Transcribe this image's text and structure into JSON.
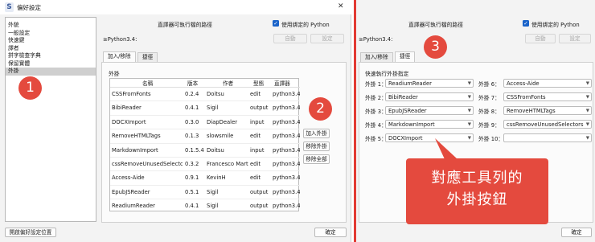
{
  "window": {
    "title": "偏好設定",
    "close": "✕"
  },
  "categories": [
    "外貌",
    "一般設定",
    "快速鍵",
    "譯者",
    "拼字檢查字典",
    "保留實體",
    "外掛"
  ],
  "selected_category": "外掛",
  "top": {
    "interpreter_label": "直譯器可執行檔的路徑",
    "use_bundled_python": "使用綁定的 Python",
    "path_value": "≥Python3.4:",
    "auto_btn": "自動",
    "set_btn": "設定"
  },
  "tabs": [
    "加入/移除",
    "捷徑"
  ],
  "plugins_section_label": "外掛",
  "table": {
    "headers": [
      "名稱",
      "版本",
      "作者",
      "型態",
      "直譯器"
    ],
    "rows": [
      [
        "CSSFromFonts",
        "0.2.4",
        "Doitsu",
        "edit",
        "python3.4"
      ],
      [
        "BibiReader",
        "0.4.1",
        "Sigil",
        "output",
        "python3.4"
      ],
      [
        "DOCXImport",
        "0.3.0",
        "DiapDealer",
        "input",
        "python3.4"
      ],
      [
        "RemoveHTMLTags",
        "0.1.3",
        "slowsmile",
        "edit",
        "python3.4"
      ],
      [
        "MarkdownImport",
        "0.1.5.4",
        "Doitsu",
        "input",
        "python3.4"
      ],
      [
        "cssRemoveUnusedSelectors",
        "0.3.2",
        "Francesco Martini",
        "edit",
        "python3.4"
      ],
      [
        "Access-Aide",
        "0.9.1",
        "KevinH",
        "edit",
        "python3.4"
      ],
      [
        "EpubJSReader",
        "0.5.1",
        "Sigil",
        "output",
        "python3.4"
      ],
      [
        "ReadiumReader",
        "0.4.1",
        "Sigil",
        "output",
        "python3.4"
      ]
    ]
  },
  "side_buttons": [
    "加入外掛",
    "移除外掛",
    "移除全部"
  ],
  "bottom": {
    "left_btn": "開啟偏好設定位置",
    "ok_btn": "確定"
  },
  "right": {
    "section_label": "快速執行外掛指定",
    "left_slots": [
      {
        "label": "外掛 1：",
        "value": "ReadiumReader"
      },
      {
        "label": "外掛 2：",
        "value": "BibiReader"
      },
      {
        "label": "外掛 3：",
        "value": "EpubJSReader"
      },
      {
        "label": "外掛 4：",
        "value": "MarkdownImport"
      },
      {
        "label": "外掛 5：",
        "value": "DOCXImport"
      }
    ],
    "right_slots": [
      {
        "label": "外掛 6：",
        "value": "Access-Aide"
      },
      {
        "label": "外掛 7：",
        "value": "CSSFromFonts"
      },
      {
        "label": "外掛 8：",
        "value": "RemoveHTMLTags"
      },
      {
        "label": "外掛 9：",
        "value": "cssRemoveUnusedSelectors"
      },
      {
        "label": "外掛 10：",
        "value": ""
      }
    ],
    "ok_btn": "確定"
  },
  "annotations": {
    "badge1": "1",
    "badge2": "2",
    "badge3": "3",
    "callout_line1": "對應工具列的",
    "callout_line2": "外掛按鈕",
    "accent_color": "#e44a3e"
  }
}
